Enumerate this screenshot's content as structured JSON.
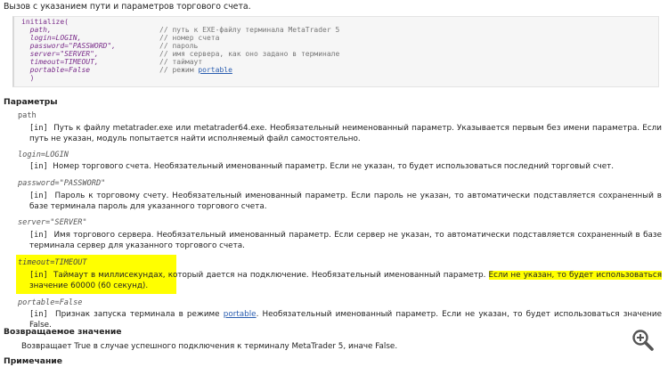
{
  "intro": "Вызов с указанием пути и параметров торгового счета.",
  "code": {
    "fn": "initialize",
    "lines": [
      {
        "arg": "path,",
        "comment": "// путь к EXE-файлу терминала MetaTrader 5",
        "link": ""
      },
      {
        "arg": "login=LOGIN,",
        "comment": "// номер счета",
        "link": ""
      },
      {
        "arg": "password=\"PASSWORD\",",
        "comment": "// пароль",
        "link": ""
      },
      {
        "arg": "server=\"SERVER\",",
        "comment": "// имя сервера, как оно задано в терминале",
        "link": ""
      },
      {
        "arg": "timeout=TIMEOUT,",
        "comment": "// таймаут",
        "link": ""
      },
      {
        "arg": "portable=False",
        "comment": "// режим ",
        "link": "portable"
      }
    ],
    "close": ")"
  },
  "params_title": "Параметры",
  "params": {
    "path": {
      "name": "path",
      "tag": "[in]",
      "desc": "Путь к файлу metatrader.exe или metatrader64.exe. Необязательный неименованный параметр. Указывается первым без имени параметра. Если путь не указан, модуль попытается найти исполняемый файл самостоятельно."
    },
    "login": {
      "name": "login=LOGIN",
      "tag": "[in]",
      "desc": "Номер торгового счета. Необязательный именованный параметр. Если не указан, то будет использоваться последний торговый счет."
    },
    "password": {
      "name": "password=\"PASSWORD\"",
      "tag": "[in]",
      "desc": "Пароль к торговому счету. Необязательный именованный параметр. Если пароль не указан, то автоматически подставляется сохраненный в базе терминала пароль для указанного торгового счета."
    },
    "server": {
      "name": "server=\"SERVER\"",
      "tag": "[in]",
      "desc": "Имя торгового сервера. Необязательный именованный параметр. Если сервер не указан, то автоматически подставляется сохраненный в базе терминала сервер для указанного торгового счета."
    },
    "timeout": {
      "name": "timeout=TIMEOUT",
      "tag": "[in]",
      "desc_a": "Таймаут в миллисекундах, который дается на подключение. Необязательный именованный параметр.",
      "desc_b": "Если не указан, то будет использоваться",
      "desc_c": "значение 60000 (60 секунд)."
    },
    "portable": {
      "name": "portable=False",
      "tag": "[in]",
      "desc_a": "Признак запуска терминала в режиме ",
      "link": "portable",
      "desc_b": ". Необязательный именованный параметр. Если не указан, то будет использоваться значение False."
    }
  },
  "return_title": "Возвращаемое значение",
  "return_text": "Возвращает True в случае успешного подключения к терминалу MetaTrader 5, иначе False.",
  "cut_heading": "Примечание",
  "colors": {
    "highlight": "#ffff00",
    "link": "#2a5db0",
    "code_bg": "#f6f6f6"
  },
  "icons": {
    "zoom": "zoom-in-icon"
  }
}
